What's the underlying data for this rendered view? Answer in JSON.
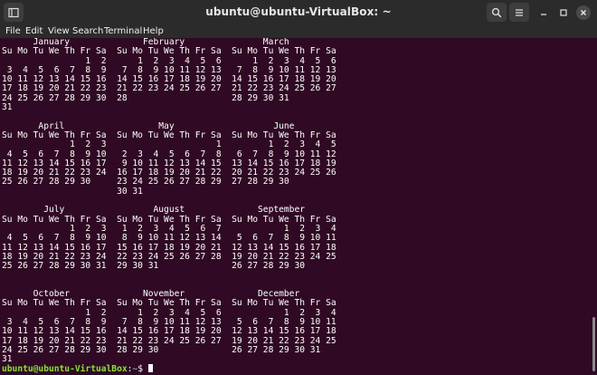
{
  "window": {
    "title": "ubuntu@ubuntu-VirtualBox: ~"
  },
  "menu": {
    "items": [
      "File",
      "Edit",
      "View",
      "Search",
      "Terminal",
      "Help"
    ]
  },
  "terminal": {
    "lines": [
      "      January              February               March",
      "Su Mo Tu We Th Fr Sa  Su Mo Tu We Th Fr Sa  Su Mo Tu We Th Fr Sa",
      "                1  2      1  2  3  4  5  6      1  2  3  4  5  6",
      " 3  4  5  6  7  8  9   7  8  9 10 11 12 13   7  8  9 10 11 12 13",
      "10 11 12 13 14 15 16  14 15 16 17 18 19 20  14 15 16 17 18 19 20",
      "17 18 19 20 21 22 23  21 22 23 24 25 26 27  21 22 23 24 25 26 27",
      "24 25 26 27 28 29 30  28                    28 29 30 31",
      "31",
      "",
      "       April                  May                   June",
      "Su Mo Tu We Th Fr Sa  Su Mo Tu We Th Fr Sa  Su Mo Tu We Th Fr Sa",
      "             1  2  3                     1         1  2  3  4  5",
      " 4  5  6  7  8  9 10   2  3  4  5  6  7  8   6  7  8  9 10 11 12",
      "11 12 13 14 15 16 17   9 10 11 12 13 14 15  13 14 15 16 17 18 19",
      "18 19 20 21 22 23 24  16 17 18 19 20 21 22  20 21 22 23 24 25 26",
      "25 26 27 28 29 30     23 24 25 26 27 28 29  27 28 29 30",
      "                      30 31",
      "",
      "        July                 August              September",
      "Su Mo Tu We Th Fr Sa  Su Mo Tu We Th Fr Sa  Su Mo Tu We Th Fr Sa",
      "             1  2  3   1  2  3  4  5  6  7            1  2  3  4",
      " 4  5  6  7  8  9 10   8  9 10 11 12 13 14   5  6  7  8  9 10 11",
      "11 12 13 14 15 16 17  15 16 17 18 19 20 21  12 13 14 15 16 17 18",
      "18 19 20 21 22 23 24  22 23 24 25 26 27 28  19 20 21 22 23 24 25",
      "25 26 27 28 29 30 31  29 30 31              26 27 28 29 30",
      "",
      "",
      "      October              November              December",
      "Su Mo Tu We Th Fr Sa  Su Mo Tu We Th Fr Sa  Su Mo Tu We Th Fr Sa",
      "                1  2      1  2  3  4  5  6            1  2  3  4",
      " 3  4  5  6  7  8  9   7  8  9 10 11 12 13   5  6  7  8  9 10 11",
      "10 11 12 13 14 15 16  14 15 16 17 18 19 20  12 13 14 15 16 17 18",
      "17 18 19 20 21 22 23  21 22 23 24 25 26 27  19 20 21 22 23 24 25",
      "24 25 26 27 28 29 30  28 29 30              26 27 28 29 30 31",
      "31"
    ],
    "prompt": {
      "user_host": "ubuntu@ubuntu-VirtualBox",
      "sep": ":",
      "path": "~",
      "symbol": "$ "
    }
  },
  "colors": {
    "terminal_bg": "#300a24",
    "titlebar_bg": "#2b2b2b",
    "prompt_user": "#8ae234",
    "prompt_path": "#729fcf"
  },
  "icons": {
    "new_tab": "new-tab-icon",
    "search": "search-icon",
    "menu": "hamburger-menu-icon",
    "minimize": "minimize-icon",
    "maximize": "maximize-icon",
    "close": "close-icon"
  }
}
